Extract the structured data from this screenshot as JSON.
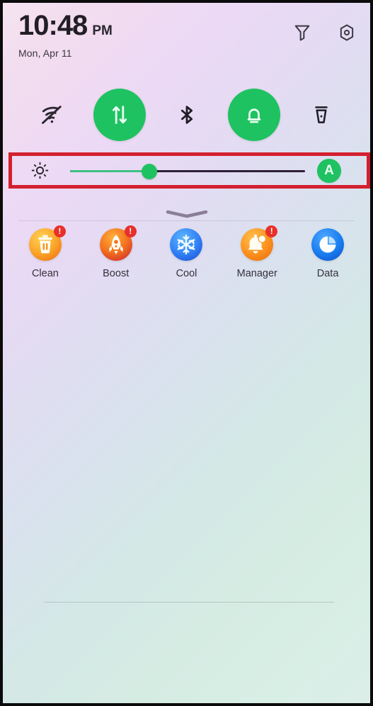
{
  "status_bar": {
    "time": "10:48",
    "ampm": "PM",
    "date": "Mon, Apr 11",
    "icons": [
      {
        "name": "filter-icon",
        "label": "Filter"
      },
      {
        "name": "settings-hex-icon",
        "label": "Settings"
      }
    ]
  },
  "quick_toggles": [
    {
      "name": "wifi-toggle",
      "label": "Wi-Fi",
      "state": "off"
    },
    {
      "name": "mobile-data-toggle",
      "label": "Mobile data",
      "state": "on"
    },
    {
      "name": "bluetooth-toggle",
      "label": "Bluetooth",
      "state": "off"
    },
    {
      "name": "sound-toggle",
      "label": "Sound",
      "state": "on"
    },
    {
      "name": "flashlight-toggle",
      "label": "Flashlight",
      "state": "off"
    }
  ],
  "brightness": {
    "icon_label": "Brightness",
    "value_percent": 33,
    "auto_label": "A",
    "auto_enabled": true,
    "highlight_color": "#d32030",
    "fill_color": "#3fbf83",
    "track_color": "#2d1f35"
  },
  "panel": {
    "handle_label": "Collapse panel"
  },
  "shortcuts": [
    {
      "label": "Clean",
      "icon": "trash-icon",
      "badge": "!",
      "color_a": "#ffc83d",
      "color_b": "#f58220"
    },
    {
      "label": "Boost",
      "icon": "rocket-icon",
      "badge": "!",
      "color_a": "#fb8c22",
      "color_b": "#e0392b"
    },
    {
      "label": "Cool",
      "icon": "snowflake-icon",
      "badge": "",
      "color_a": "#3aa0ff",
      "color_b": "#2a6ef0"
    },
    {
      "label": "Manager",
      "icon": "bell-icon",
      "badge": "!",
      "color_a": "#ffa426",
      "color_b": "#f4760d"
    },
    {
      "label": "Data",
      "icon": "pie-chart-icon",
      "badge": "",
      "color_a": "#2f9bff",
      "color_b": "#0d6ae8"
    }
  ],
  "theme": {
    "accent_green": "#1fc261",
    "text_dark": "#221e26",
    "badge_red": "#e8302a"
  }
}
